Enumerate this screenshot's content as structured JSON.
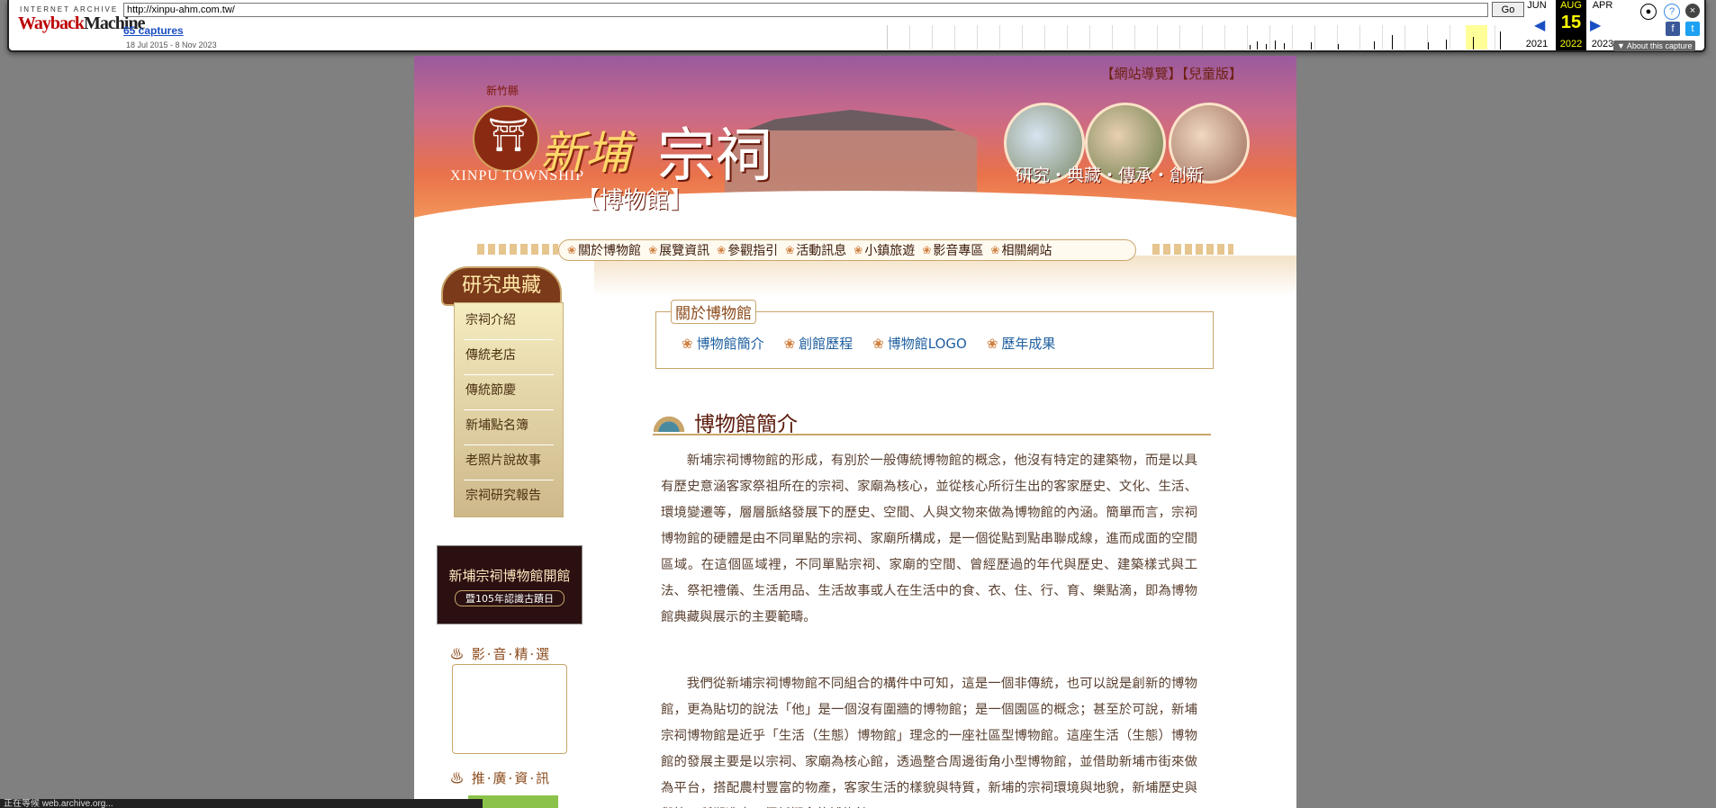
{
  "wayback": {
    "logo_top": "INTERNET ARCHIVE",
    "logo_main_a": "Wayback",
    "logo_main_b": "Machine",
    "url": "http://xinpu-ahm.com.tw/",
    "go_label": "Go",
    "captures": "65 captures",
    "range": "18 Jul 2015 - 8 Nov 2023",
    "prev_month": "JUN",
    "prev_year": "2021",
    "cur_month": "AUG",
    "cur_day": "15",
    "cur_year": "2022",
    "next_month": "APR",
    "next_year": "2023",
    "about": "▼ About this capture"
  },
  "site": {
    "top_links": "【網站導覽】【兒童版】",
    "county": "新竹縣",
    "township_en": "XINPU TOWNSHIP",
    "title_a": "新埔",
    "title_b": "宗祠",
    "title_c": "【博物館】",
    "slogan": "研究・典藏・傳承・創新",
    "nav": [
      "關於博物館",
      "展覽資訊",
      "參觀指引",
      "活動訊息",
      "小鎮旅遊",
      "影音專區",
      "相關網站"
    ],
    "sidebar_head": "研究典藏",
    "sidebar": [
      "宗祠介紹",
      "傳統老店",
      "傳統節慶",
      "新埔點名簿",
      "老照片說故事",
      "宗祠研究報告"
    ],
    "promo_line1": "新埔宗祠博物館開館",
    "promo_line2": "暨105年認識古蹟日",
    "video_title": "影·音·精·選",
    "promo_title": "推·廣·資·訊",
    "about_label": "關於博物館",
    "about_links": [
      "博物館簡介",
      "創館歷程",
      "博物館LOGO",
      "歷年成果"
    ],
    "content_title": "博物館簡介",
    "para1": "新埔宗祠博物館的形成，有別於一般傳統博物館的概念，他沒有特定的建築物，而是以具有歷史意涵客家祭祖所在的宗祠、家廟為核心，並從核心所衍生出的客家歷史、文化、生活、環境變遷等，層層脈絡發展下的歷史、空間、人與文物來做為博物館的內涵。簡單而言，宗祠博物館的硬體是由不同單點的宗祠、家廟所構成，是一個從點到點串聯成線，進而成面的空間區域。在這個區域裡，不同單點宗祠、家廟的空間、曾經歷過的年代與歷史、建築樣式與工法、祭祀禮儀、生活用品、生活故事或人在生活中的食、衣、住、行、育、樂點滴，即為博物館典藏與展示的主要範疇。",
    "para2": "我們從新埔宗祠博物館不同組合的構件中可知，這是一個非傳統，也可以說是創新的博物館，更為貼切的說法「他」是一個沒有圍牆的博物館；是一個園區的概念；甚至於可說，新埔宗祠博物館是近乎「生活（生態）博物館」理念的一座社區型博物館。這座生活（生態）博物館的發展主要是以宗祠、家廟為核心館，透過整合周邊街角小型博物館，並借助新埔市街來做為平台，搭配農村豐富的物產，客家生活的樣貌與特質，新埔的宗祠環境與地貌，新埔歷史與舉等，所塑造出一個新概念的博物館。"
  },
  "status_text": "正在等候 web.archive.org..."
}
